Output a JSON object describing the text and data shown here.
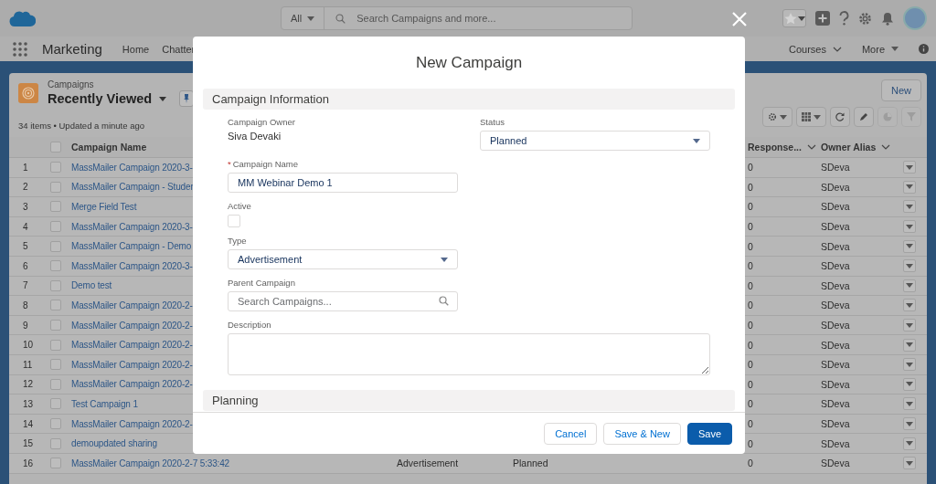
{
  "header": {
    "search_scope": "All",
    "search": {
      "placeholder": "Search Campaigns and more..."
    }
  },
  "nav": {
    "app_name": "Marketing",
    "items": [
      {
        "label": "Home",
        "kind": "plain"
      },
      {
        "label": "Chatter",
        "kind": "plain"
      }
    ],
    "right_items": [
      {
        "label": "Courses",
        "kind": "chevron"
      },
      {
        "label": "More",
        "kind": "caret"
      }
    ]
  },
  "list_view": {
    "object": "Campaigns",
    "title": "Recently Viewed",
    "summary": "34 items • Updated a minute ago",
    "new_button": "New",
    "toolbar": [
      {
        "kind": "settings",
        "menu": true,
        "disabled": false
      },
      {
        "kind": "table",
        "menu": true,
        "disabled": false
      },
      {
        "kind": "refresh",
        "menu": false,
        "disabled": false
      },
      {
        "kind": "edit",
        "menu": false,
        "disabled": false
      },
      {
        "kind": "chart",
        "menu": false,
        "disabled": true
      },
      {
        "kind": "filter",
        "menu": false,
        "disabled": true
      }
    ]
  },
  "table": {
    "all_checked": false,
    "columns": [
      {
        "label": "Campaign Name",
        "kind": "name"
      },
      {
        "label": "Response...",
        "kind": "response"
      },
      {
        "label": "Owner Alias",
        "kind": "owner"
      }
    ],
    "rows": [
      {
        "number": "1",
        "checked": false,
        "name": "MassMailer Campaign 2020-3-",
        "response": "0",
        "owner": "SDeva"
      },
      {
        "number": "2",
        "checked": false,
        "name": "MassMailer Campaign - Studer",
        "response": "0",
        "owner": "SDeva"
      },
      {
        "number": "3",
        "checked": false,
        "name": "Merge Field Test",
        "response": "0",
        "owner": "SDeva"
      },
      {
        "number": "4",
        "checked": false,
        "name": "MassMailer Campaign 2020-3-",
        "response": "0",
        "owner": "SDeva"
      },
      {
        "number": "5",
        "checked": false,
        "name": "MassMailer Campaign - Demo",
        "response": "0",
        "owner": "SDeva"
      },
      {
        "number": "6",
        "checked": false,
        "name": "MassMailer Campaign 2020-3-",
        "response": "0",
        "owner": "SDeva"
      },
      {
        "number": "7",
        "checked": false,
        "name": "Demo test",
        "response": "0",
        "owner": "SDeva"
      },
      {
        "number": "8",
        "checked": false,
        "name": "MassMailer Campaign 2020-2-",
        "response": "0",
        "owner": "SDeva"
      },
      {
        "number": "9",
        "checked": false,
        "name": "MassMailer Campaign 2020-2-",
        "response": "0",
        "owner": "SDeva"
      },
      {
        "number": "10",
        "checked": false,
        "name": "MassMailer Campaign 2020-2-",
        "response": "0",
        "owner": "SDeva"
      },
      {
        "number": "11",
        "checked": false,
        "name": "MassMailer Campaign 2020-2-",
        "response": "0",
        "owner": "SDeva"
      },
      {
        "number": "12",
        "checked": false,
        "name": "MassMailer Campaign 2020-2-",
        "response": "0",
        "owner": "SDeva"
      },
      {
        "number": "13",
        "checked": false,
        "name": "Test Campaign 1",
        "response": "0",
        "owner": "SDeva"
      },
      {
        "number": "14",
        "checked": false,
        "name": "MassMailer Campaign 2020-2-",
        "response": "0",
        "owner": "SDeva"
      },
      {
        "number": "15",
        "checked": false,
        "name": "demoupdated sharing",
        "response": "0",
        "owner": "SDeva"
      },
      {
        "number": "16",
        "checked": false,
        "name": "MassMailer Campaign 2020-2-7 5:33:42",
        "type": "Advertisement",
        "status": "Planned",
        "response": "0",
        "owner": "SDeva"
      }
    ]
  },
  "modal": {
    "title": "New Campaign",
    "sections": [
      {
        "title": "Campaign Information",
        "rows": [
          [
            {
              "kind": "display",
              "label": "Campaign Owner",
              "value": "Siva Devaki"
            },
            {
              "kind": "picklist",
              "label": "Status",
              "value": "Planned"
            }
          ],
          [
            {
              "kind": "text",
              "label": "Campaign Name",
              "required_mark": "*",
              "value": "MM Webinar Demo 1"
            }
          ],
          [
            {
              "kind": "checkbox",
              "label": "Active",
              "checked": false
            }
          ],
          [
            {
              "kind": "picklist",
              "label": "Type",
              "value": "Advertisement"
            }
          ],
          [
            {
              "kind": "lookup",
              "label": "Parent Campaign",
              "placeholder": "Search Campaigns..."
            }
          ],
          [
            {
              "kind": "textarea",
              "label": "Description"
            }
          ]
        ]
      },
      {
        "title": "Planning"
      }
    ],
    "buttons": [
      {
        "label": "Cancel",
        "kind": "neutral"
      },
      {
        "label": "Save & New",
        "kind": "neutral"
      },
      {
        "label": "Save",
        "kind": "brand"
      }
    ]
  }
}
